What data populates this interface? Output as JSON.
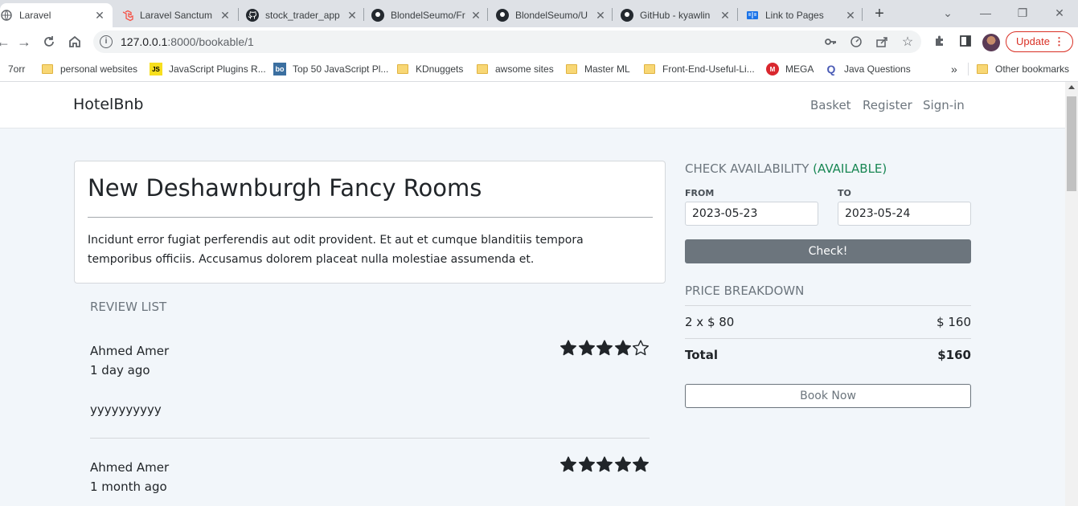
{
  "browser": {
    "tabs": [
      {
        "title": "Laravel",
        "active": true
      },
      {
        "title": "Laravel Sanctum"
      },
      {
        "title": "stock_trader_app"
      },
      {
        "title": "BlondelSeumo/Fr"
      },
      {
        "title": "BlondelSeumo/U"
      },
      {
        "title": "GitHub - kyawlin"
      },
      {
        "title": "Link to Pages"
      }
    ],
    "url_host": "127.0.0.1",
    "url_path": ":8000/bookable/1",
    "update_label": "Update",
    "bookmarks": [
      {
        "label": "7orr"
      },
      {
        "label": "personal websites"
      },
      {
        "label": "JavaScript Plugins R..."
      },
      {
        "label": "Top 50 JavaScript Pl..."
      },
      {
        "label": "KDnuggets"
      },
      {
        "label": "awsome sites"
      },
      {
        "label": "Master ML"
      },
      {
        "label": "Front-End-Useful-Li..."
      },
      {
        "label": "MEGA"
      },
      {
        "label": "Java Questions"
      }
    ],
    "bookmarks_overflow": "»",
    "other_bookmarks": "Other bookmarks"
  },
  "navbar": {
    "brand": "HotelBnb",
    "links": [
      "Basket",
      "Register",
      "Sign-in"
    ]
  },
  "bookable": {
    "title": "New Deshawnburgh Fancy Rooms",
    "description": "Incidunt error fugiat perferendis aut odit provident. Et aut et cumque blanditiis tempora temporibus officiis. Accusamus dolorem placeat nulla molestiae assumenda et."
  },
  "reviews": {
    "heading": "Review list",
    "items": [
      {
        "author": "Ahmed Amer",
        "time": "1 day ago",
        "content": "yyyyyyyyyy",
        "rating": 4
      },
      {
        "author": "Ahmed Amer",
        "time": "1 month ago",
        "content": "",
        "rating": 5
      }
    ]
  },
  "availability": {
    "heading": "Check Availability",
    "status": "(AVAILABLE)",
    "status_color": "#198754",
    "from_label": "From",
    "to_label": "To",
    "from_value": "2023-05-23",
    "to_value": "2023-05-24",
    "check_label": "Check!"
  },
  "price": {
    "heading": "Price breakdown",
    "line_label": "2 x $ 80",
    "line_amount": "$ 160",
    "total_label": "Total",
    "total_amount": "$160",
    "book_label": "Book Now"
  }
}
